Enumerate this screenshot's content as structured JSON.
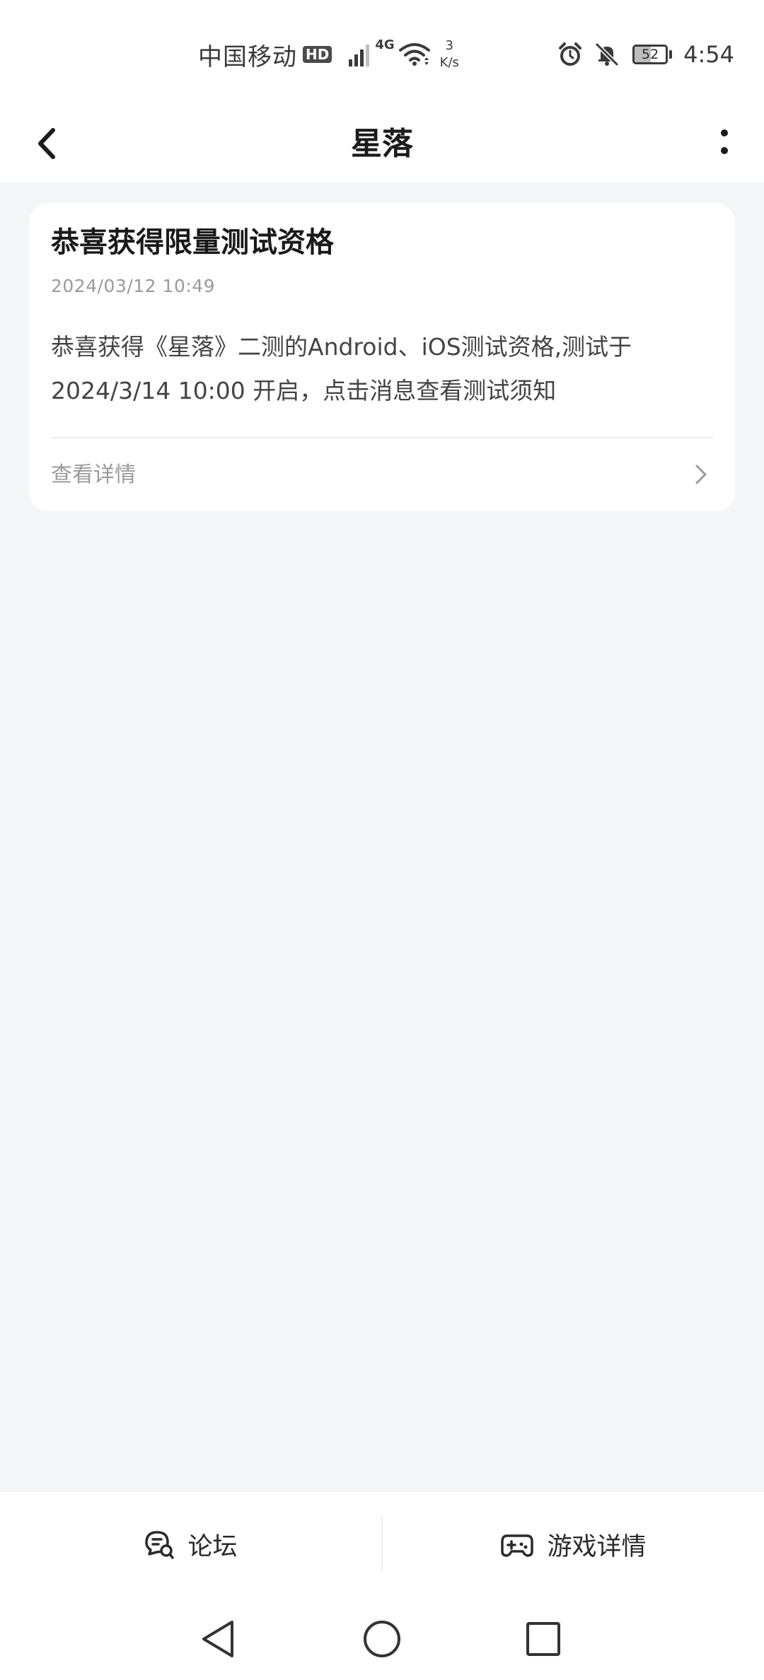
{
  "status_bar": {
    "carrier": "中国移动",
    "hd": "HD",
    "network": "4G",
    "speed_value": "3",
    "speed_unit": "K/s",
    "battery_level": "52",
    "time": "4:54"
  },
  "header": {
    "title": "星落"
  },
  "message": {
    "title": "恭喜获得限量测试资格",
    "date": "2024/03/12 10:49",
    "body": "恭喜获得《星落》二测的Android、iOS测试资格,测试于2024/3/14 10:00 开启，点击消息查看测试须知",
    "link_label": "查看详情"
  },
  "bottom_bar": {
    "forum_label": "论坛",
    "game_details_label": "游戏详情"
  },
  "colors": {
    "page_background": "#f5f6f8",
    "card_background": "#ffffff",
    "title_text": "#1b1b1b",
    "secondary_text": "#9a9a9a"
  }
}
